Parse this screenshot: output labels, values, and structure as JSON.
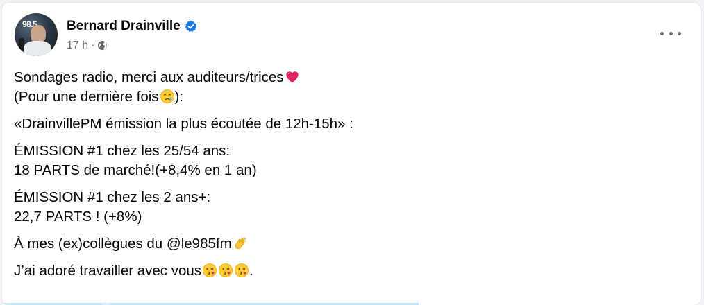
{
  "post": {
    "author": "Bernard Drainville",
    "timestamp": "17 h",
    "separator": "·",
    "avatar_logo_text": "98.5",
    "lines": {
      "p1_l1": "Sondages radio, merci aux auditeurs/trices",
      "p1_l2a": "(Pour une dernière fois",
      "p1_l2b": "):",
      "p2": "«DrainvillePM émission la plus écoutée de 12h-15h» :",
      "p3_l1": "ÉMISSION #1 chez les 25/54 ans:",
      "p3_l2": "18 PARTS de marché!(+8,4% en 1 an)",
      "p4_l1": "ÉMISSION #1 chez les 2 ans+:",
      "p4_l2": "22,7 PARTS ! (+8%)",
      "p5": "À mes (ex)collègues du @le985fm",
      "p6a": "J’ai adoré travailler avec vous",
      "p6b": "."
    },
    "icons": {
      "verified": "verified-badge-icon",
      "privacy": "globe-icon",
      "menu": "more-options-icon",
      "emoji_heart": "red-heart-emoji",
      "emoji_tear": "crying-face-emoji",
      "emoji_clap": "clapping-hands-emoji",
      "emoji_kiss": "face-blowing-kiss-emoji"
    },
    "colors": {
      "verified": "#1877f2",
      "secondary_text": "#65676b",
      "heart": "#e0245e"
    }
  }
}
